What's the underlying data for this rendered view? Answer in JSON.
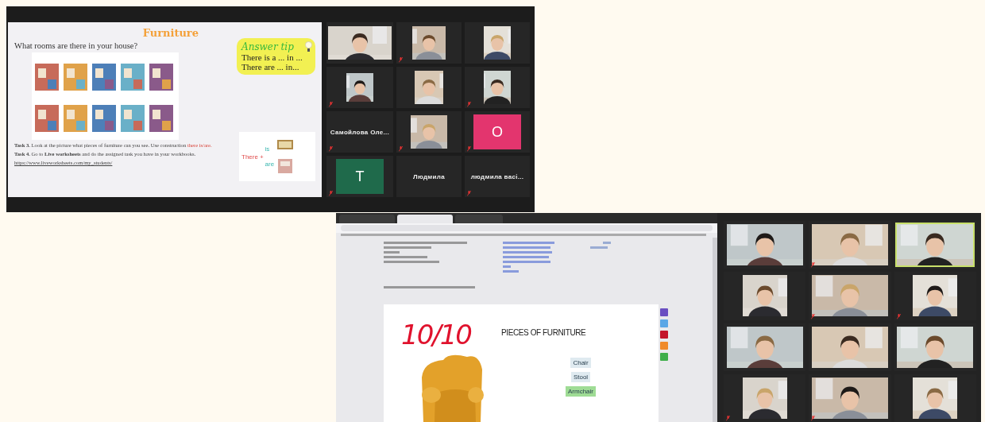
{
  "meeting_1": {
    "slide": {
      "title": "Furniture",
      "question": "What rooms are there in your house?",
      "answer_tip": {
        "heading": "Answer tip",
        "lines": [
          "There is a ... in ...",
          "There are ... in..."
        ]
      },
      "there_card": {
        "word": "There",
        "plus": "+",
        "forms": [
          "is",
          "are"
        ]
      },
      "tasks": [
        {
          "label": "Task 3.",
          "text": "Look at the picture what pieces of furniture can you see. Use construction",
          "highlight": "there is/are."
        },
        {
          "label": "Task 4.",
          "text": "Go to **Live worksheets** and do the assigned task you have in your workbooks."
        }
      ],
      "link": "https://www.liveworksheets.com/my_students/"
    },
    "participants": [
      {
        "kind": "video",
        "muted": false
      },
      {
        "kind": "video",
        "muted": true
      },
      {
        "kind": "video",
        "muted": false
      },
      {
        "kind": "video",
        "muted": true
      },
      {
        "kind": "video",
        "muted": false
      },
      {
        "kind": "video",
        "muted": true
      },
      {
        "kind": "name",
        "name": "Самойлова Оле...",
        "muted": true
      },
      {
        "kind": "video",
        "muted": true
      },
      {
        "kind": "avatar",
        "letter": "O",
        "color": "#e3356e",
        "muted": true
      },
      {
        "kind": "avatar",
        "letter": "T",
        "color": "#1f6a4b",
        "muted": true
      },
      {
        "kind": "name",
        "name": "Людмила",
        "muted": false
      },
      {
        "kind": "name",
        "name": "людмила васі...",
        "muted": true
      }
    ]
  },
  "meeting_2": {
    "browser_tabs": [
      {
        "selected": false
      },
      {
        "selected": true
      },
      {
        "selected": false
      }
    ],
    "worksheet": {
      "score": "10/10",
      "title": "PIECES OF FURNITURE",
      "options": [
        {
          "label": "Chair",
          "selected": false
        },
        {
          "label": "Stool",
          "selected": false
        },
        {
          "label": "Armchair",
          "selected": true
        }
      ]
    },
    "participants": [
      {
        "kind": "video",
        "muted": false,
        "speaking": false
      },
      {
        "kind": "video",
        "muted": true,
        "speaking": false
      },
      {
        "kind": "video",
        "muted": false,
        "speaking": true
      },
      {
        "kind": "video",
        "muted": false,
        "speaking": false
      },
      {
        "kind": "video",
        "muted": true,
        "speaking": false
      },
      {
        "kind": "video",
        "muted": true,
        "speaking": false
      },
      {
        "kind": "video",
        "muted": false,
        "speaking": false
      },
      {
        "kind": "video",
        "muted": false,
        "speaking": false
      },
      {
        "kind": "video",
        "muted": false,
        "speaking": false
      },
      {
        "kind": "video",
        "muted": true,
        "speaking": false
      },
      {
        "kind": "video",
        "muted": true,
        "speaking": false
      },
      {
        "kind": "video",
        "muted": false,
        "speaking": false
      }
    ]
  }
}
